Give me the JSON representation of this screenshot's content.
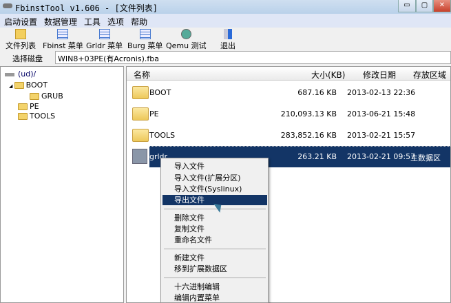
{
  "window": {
    "title": "FbinstTool v1.606 - [文件列表]",
    "minimize": "▭",
    "maximize": "▢",
    "close": "✕"
  },
  "menu": [
    "启动设置",
    "数据管理",
    "工具",
    "选项",
    "帮助"
  ],
  "toolbar": [
    {
      "label": "文件列表",
      "icon": "folder-icon"
    },
    {
      "label": "Fbinst 菜单",
      "icon": "document-icon"
    },
    {
      "label": "Grldr 菜单",
      "icon": "document-icon"
    },
    {
      "label": "Burg 菜单",
      "icon": "document-icon"
    },
    {
      "label": "Qemu 测试",
      "icon": "qemu-icon"
    },
    {
      "label": "退出",
      "icon": "exit-icon"
    }
  ],
  "disk": {
    "label": "选择磁盘",
    "value": "WIN8+03PE(有Acronis).fba"
  },
  "tree": {
    "root": "(ud)/",
    "items": [
      "BOOT",
      "GRUB",
      "PE",
      "TOOLS"
    ]
  },
  "columns": [
    "名称",
    "大小(KB)",
    "修改日期",
    "存放区域"
  ],
  "files": [
    {
      "name": "BOOT",
      "size": "687.16 KB",
      "date": "2013-02-13 22:36",
      "area": ""
    },
    {
      "name": "PE",
      "size": "210,093.13 KB",
      "date": "2013-06-21 15:48",
      "area": ""
    },
    {
      "name": "TOOLS",
      "size": "283,852.16 KB",
      "date": "2013-02-21 15:57",
      "area": ""
    },
    {
      "name": "grldr",
      "size": "263.21 KB",
      "date": "2013-02-21 09:57",
      "area": "主数据区"
    }
  ],
  "context_menu": [
    "导入文件",
    "导入文件(扩展分区)",
    "导入文件(Syslinux)",
    "导出文件",
    "删除文件",
    "复制文件",
    "重命名文件",
    "新建文件",
    "移到扩展数据区",
    "十六进制编辑",
    "编辑内置菜单"
  ]
}
